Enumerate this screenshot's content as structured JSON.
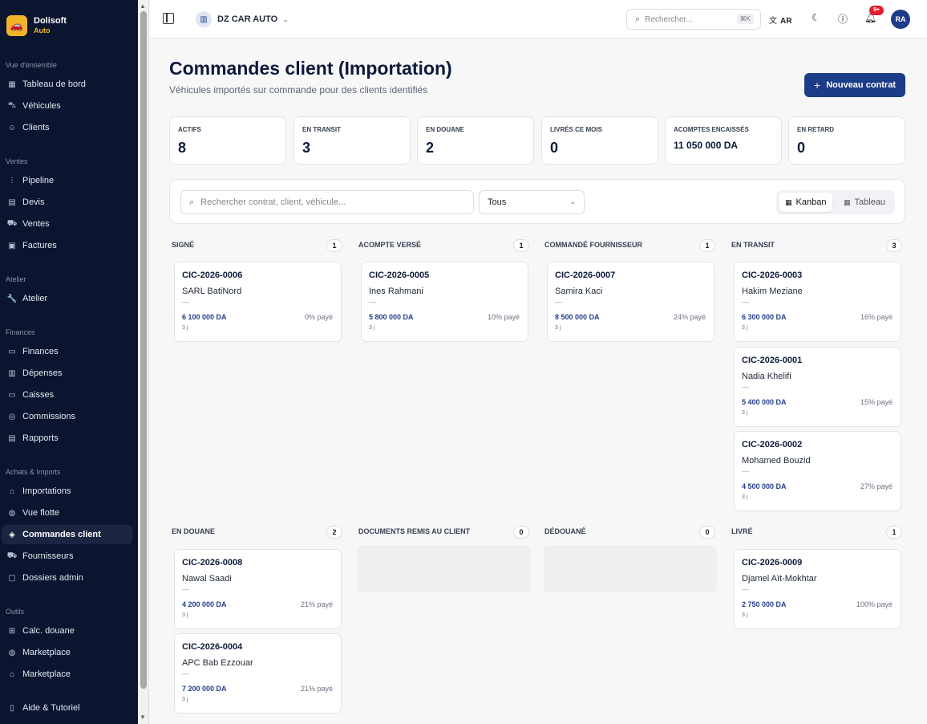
{
  "brand": {
    "name": "Dolisoft",
    "sub": "Auto"
  },
  "sidebar": {
    "sections": [
      {
        "title": "Vue d'ensemble",
        "items": [
          {
            "label": "Tableau de bord",
            "icon": "grid-icon"
          },
          {
            "label": "Véhicules",
            "icon": "car-icon"
          },
          {
            "label": "Clients",
            "icon": "users-icon"
          }
        ]
      },
      {
        "title": "Ventes",
        "items": [
          {
            "label": "Pipeline",
            "icon": "pipeline-icon"
          },
          {
            "label": "Devis",
            "icon": "document-icon"
          },
          {
            "label": "Ventes",
            "icon": "cart-icon"
          },
          {
            "label": "Factures",
            "icon": "invoice-icon"
          }
        ]
      },
      {
        "title": "Atelier",
        "items": [
          {
            "label": "Atelier",
            "icon": "wrench-icon"
          }
        ]
      },
      {
        "title": "Finances",
        "items": [
          {
            "label": "Finances",
            "icon": "wallet-icon"
          },
          {
            "label": "Dépenses",
            "icon": "receipt-icon"
          },
          {
            "label": "Caisses",
            "icon": "cashbox-icon"
          },
          {
            "label": "Commissions",
            "icon": "target-icon"
          },
          {
            "label": "Rapports",
            "icon": "report-icon"
          }
        ]
      },
      {
        "title": "Achats & Imports",
        "items": [
          {
            "label": "Importations",
            "icon": "package-icon"
          },
          {
            "label": "Vue flotte",
            "icon": "globe-icon"
          },
          {
            "label": "Commandes client",
            "icon": "box-icon",
            "active": true
          },
          {
            "label": "Fournisseurs",
            "icon": "truck-icon"
          },
          {
            "label": "Dossiers admin",
            "icon": "folder-icon"
          }
        ]
      },
      {
        "title": "Outils",
        "items": [
          {
            "label": "Calc. douane",
            "icon": "calculator-icon"
          },
          {
            "label": "Marketplace",
            "icon": "globe-icon"
          },
          {
            "label": "Marketplace",
            "icon": "store-icon"
          }
        ]
      }
    ],
    "footer_item": {
      "label": "Aide & Tutoriel",
      "icon": "book-icon"
    }
  },
  "topbar": {
    "workspace": "DZ CAR AUTO",
    "search_placeholder": "Rechercher...",
    "search_shortcut": "⌘K",
    "lang": "AR",
    "notif_count": "9+",
    "user_initials": "RA"
  },
  "page": {
    "title": "Commandes client (Importation)",
    "subtitle": "Véhicules importés sur commande pour des clients identifiés",
    "new_button": "Nouveau contrat"
  },
  "kpis": [
    {
      "label": "Actifs",
      "value": "8"
    },
    {
      "label": "En transit",
      "value": "3"
    },
    {
      "label": "En douane",
      "value": "2"
    },
    {
      "label": "Livrés ce mois",
      "value": "0"
    },
    {
      "label": "Acomptes encaissés",
      "value": "11 050 000 DA"
    },
    {
      "label": "En retard",
      "value": "0"
    }
  ],
  "filters": {
    "search_placeholder": "Rechercher contrat, client, véhicule...",
    "status_selected": "Tous",
    "view_kanban": "Kanban",
    "view_table": "Tableau"
  },
  "columns": [
    {
      "title": "Signé",
      "count": "1",
      "cards": [
        {
          "code": "CIC-2026-0006",
          "client": "SARL BatiNord",
          "dash": "—",
          "amount": "6 100 000 DA",
          "paid": "0% payé",
          "days": "3 j"
        }
      ]
    },
    {
      "title": "Acompte versé",
      "count": "1",
      "cards": [
        {
          "code": "CIC-2026-0005",
          "client": "Ines Rahmani",
          "dash": "—",
          "amount": "5 800 000 DA",
          "paid": "10% payé",
          "days": "3 j"
        }
      ]
    },
    {
      "title": "Commandé fournisseur",
      "count": "1",
      "cards": [
        {
          "code": "CIC-2026-0007",
          "client": "Samira Kaci",
          "dash": "—",
          "amount": "8 500 000 DA",
          "paid": "24% payé",
          "days": "3 j"
        }
      ]
    },
    {
      "title": "En transit",
      "count": "3",
      "cards": [
        {
          "code": "CIC-2026-0003",
          "client": "Hakim Meziane",
          "dash": "—",
          "amount": "6 300 000 DA",
          "paid": "16% payé",
          "days": "3 j"
        },
        {
          "code": "CIC-2026-0001",
          "client": "Nadia Khelifi",
          "dash": "—",
          "amount": "5 400 000 DA",
          "paid": "15% payé",
          "days": "3 j"
        },
        {
          "code": "CIC-2026-0002",
          "client": "Mohamed Bouzid",
          "dash": "—",
          "amount": "4 500 000 DA",
          "paid": "27% payé",
          "days": "3 j"
        }
      ]
    },
    {
      "title": "En douane",
      "count": "2",
      "cards": [
        {
          "code": "CIC-2026-0008",
          "client": "Nawal Saadi",
          "dash": "—",
          "amount": "4 200 000 DA",
          "paid": "21% payé",
          "days": "3 j"
        },
        {
          "code": "CIC-2026-0004",
          "client": "APC Bab Ezzouar",
          "dash": "—",
          "amount": "7 200 000 DA",
          "paid": "21% payé",
          "days": "3 j"
        }
      ]
    },
    {
      "title": "Documents remis au client",
      "count": "0",
      "cards": []
    },
    {
      "title": "Dédouané",
      "count": "0",
      "cards": []
    },
    {
      "title": "Livré",
      "count": "1",
      "cards": [
        {
          "code": "CIC-2026-0009",
          "client": "Djamel Aït-Mokhtar",
          "dash": "—",
          "amount": "2 750 000 DA",
          "paid": "100% payé",
          "days": "3 j"
        }
      ]
    }
  ]
}
